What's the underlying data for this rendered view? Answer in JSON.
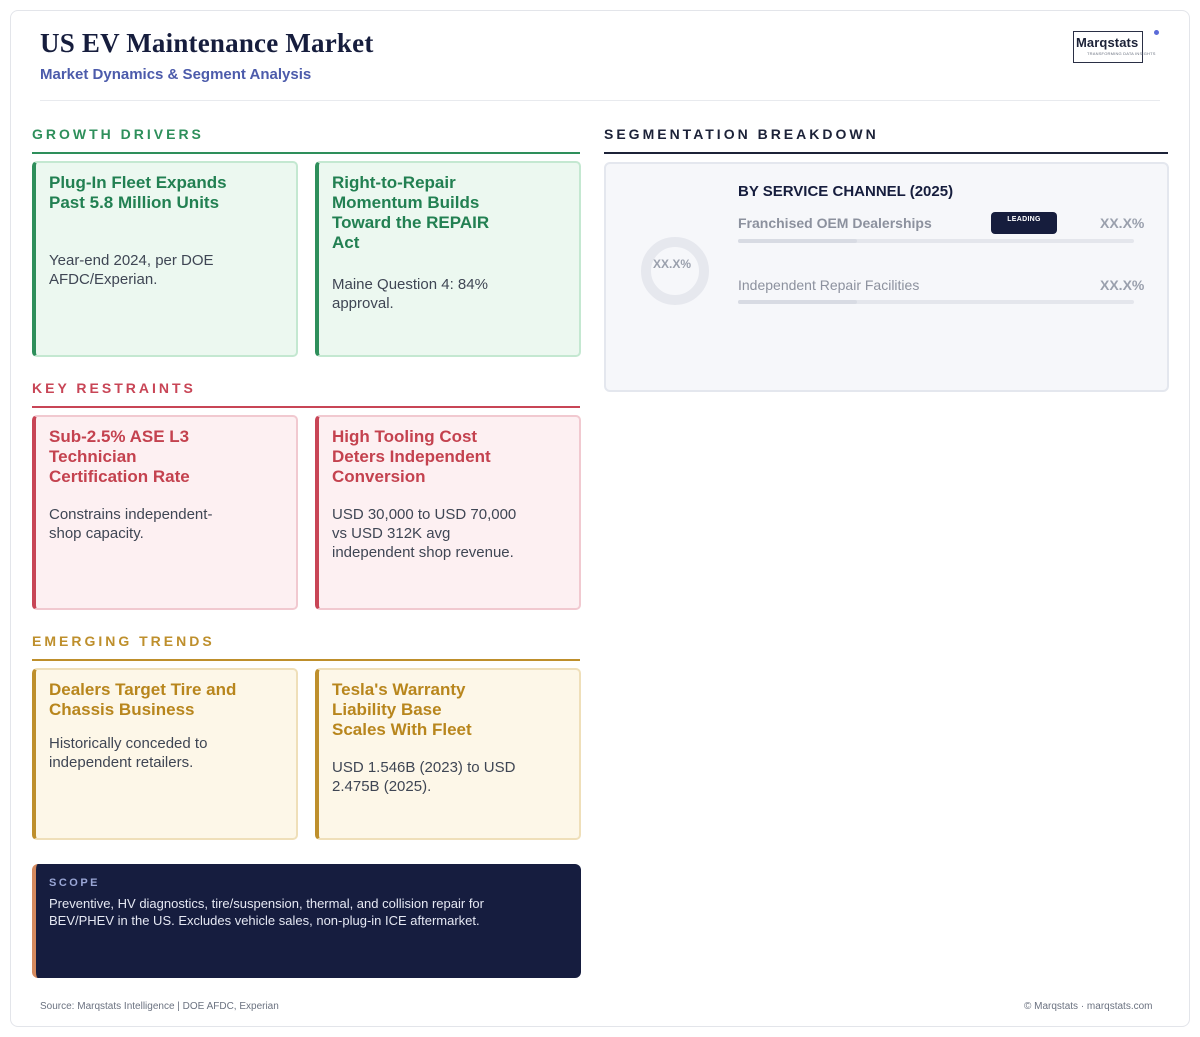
{
  "header": {
    "title": "US EV Maintenance Market",
    "subtitle": "Market Dynamics & Segment Analysis",
    "logo_text": "Marqstats",
    "logo_tagline": "TRANSFORMING DATA INSIGHTS"
  },
  "growth_drivers": {
    "label": "GROWTH DRIVERS",
    "cards": [
      {
        "title": "Plug-In Fleet Expands Past 5.8 Million Units",
        "body": "Year-end 2024, per DOE AFDC/Experian."
      },
      {
        "title": "Right-to-Repair Momentum Builds Toward the REPAIR Act",
        "body": "Maine Question 4: 84% approval."
      }
    ]
  },
  "key_restraints": {
    "label": "KEY RESTRAINTS",
    "cards": [
      {
        "title": "Sub-2.5% ASE L3 Technician Certification Rate",
        "body": "Constrains independent-shop capacity."
      },
      {
        "title": "High Tooling Cost Deters Independent Conversion",
        "body": "USD 30,000 to USD 70,000 vs USD 312K avg independent shop revenue."
      }
    ]
  },
  "emerging_trends": {
    "label": "EMERGING TRENDS",
    "cards": [
      {
        "title": "Dealers Target Tire and Chassis Business",
        "body": "Historically conceded to independent retailers."
      },
      {
        "title": "Tesla's Warranty Liability Base Scales With Fleet",
        "body": "USD 1.546B (2023) to USD 2.475B (2025)."
      }
    ]
  },
  "scope": {
    "label": "SCOPE",
    "text": "Preventive, HV diagnostics, tire/suspension, thermal, and collision repair for BEV/PHEV in the US. Excludes vehicle sales, non-plug-in ICE aftermarket."
  },
  "segmentation": {
    "label": "SEGMENTATION BREAKDOWN",
    "heading": "BY SERVICE CHANNEL (2025)",
    "donut_label": "XX.X%",
    "leading_badge": "LEADING",
    "rows": [
      {
        "name": "Franchised OEM Dealerships",
        "value": "XX.X%",
        "fill_fraction": 0.3
      },
      {
        "name": "Independent Repair Facilities",
        "value": "XX.X%",
        "fill_fraction": 0.3
      }
    ]
  },
  "footer": {
    "source": "Source: Marqstats Intelligence | DOE AFDC, Experian",
    "copyright": "© Marqstats · marqstats.com"
  },
  "colors": {
    "navy": "#161d3d",
    "green": "#2e8f5b",
    "red": "#c84556",
    "gold": "#be8f2c",
    "accent_blue": "#4c5bab"
  }
}
